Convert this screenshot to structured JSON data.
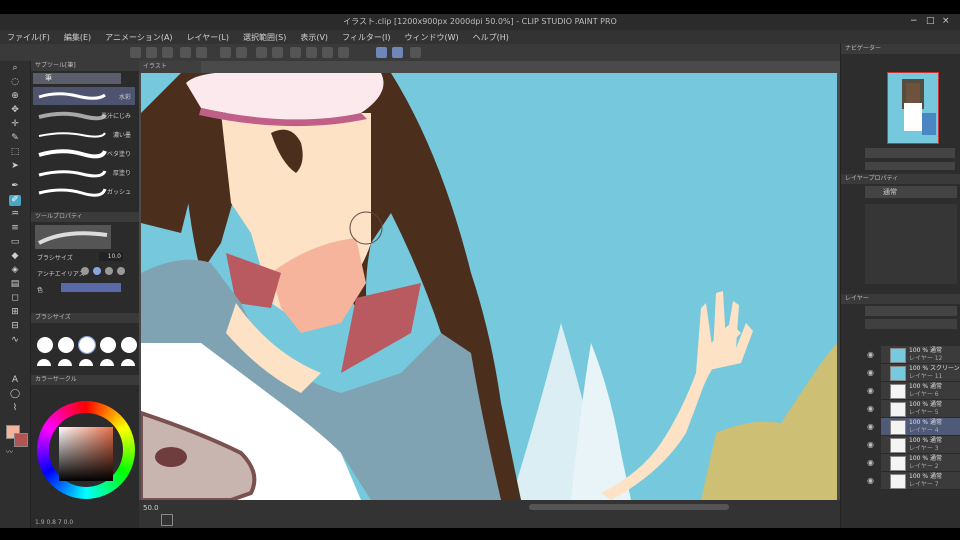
{
  "window": {
    "title": "イラスト.clip [1200x900px 2000dpi 50.0%] - CLIP STUDIO PAINT PRO",
    "controls": [
      "−",
      "□",
      "×"
    ]
  },
  "menu": [
    "ファイル(F)",
    "編集(E)",
    "アニメーション(A)",
    "レイヤー(L)",
    "選択範囲(S)",
    "表示(V)",
    "フィルター(I)",
    "ウィンドウ(W)",
    "ヘルプ(H)"
  ],
  "doc_tab": "イラスト",
  "left_panel": {
    "subtool_header": "サブツール[筆]",
    "subtool_group": "筆",
    "brushes": [
      {
        "label": "水彩",
        "selected": true
      },
      {
        "label": "墨汁にじみ",
        "selected": false
      },
      {
        "label": "濃い墨",
        "selected": false
      },
      {
        "label": "ベタ塗り",
        "selected": false
      },
      {
        "label": "厚塗り",
        "selected": false
      },
      {
        "label": "ガッシュ",
        "selected": false
      }
    ],
    "tool_prop_header": "ツールプロパティ",
    "brush_size_label": "ブラシサイズ",
    "brush_size_value": "10.0",
    "anti_alias_label": "アンチエイリアス",
    "color_label": "色",
    "brush_size_header": "ブラシサイズ",
    "color_header": "カラーサークル",
    "coord_readout": "1.9 0.8 7 0.0"
  },
  "status": {
    "zoom": "50.0"
  },
  "right_panel": {
    "navigator_header": "ナビゲーター",
    "layer_props_header": "レイヤープロパティ",
    "layer_header": "レイヤー",
    "blend_mode": "通常",
    "opacity": "100",
    "layers": [
      {
        "pct": "100 % 通常",
        "name": "レイヤー 12",
        "thumb": "blue",
        "selected": false
      },
      {
        "pct": "100 % スクリーン",
        "name": "レイヤー 11",
        "thumb": "blue",
        "selected": false
      },
      {
        "pct": "100 % 通常",
        "name": "レイヤー 6",
        "thumb": "white",
        "selected": false
      },
      {
        "pct": "100 % 通常",
        "name": "レイヤー 5",
        "thumb": "white",
        "selected": false
      },
      {
        "pct": "100 % 通常",
        "name": "レイヤー 4",
        "thumb": "white",
        "selected": true
      },
      {
        "pct": "100 % 通常",
        "name": "レイヤー 3",
        "thumb": "white",
        "selected": false
      },
      {
        "pct": "100 % 通常",
        "name": "レイヤー 2",
        "thumb": "white",
        "selected": false
      },
      {
        "pct": "100 % 通常",
        "name": "レイヤー 7",
        "thumb": "white",
        "selected": false
      }
    ]
  },
  "colors": {
    "sky": "#76c9dc",
    "hair": "#4b2e1c",
    "skin": "#fde2c6",
    "shadow_pink": "#f7b49c",
    "collar": "#b85a60",
    "jacket": "#7fa3b3",
    "main_color": "#f2b49a"
  }
}
